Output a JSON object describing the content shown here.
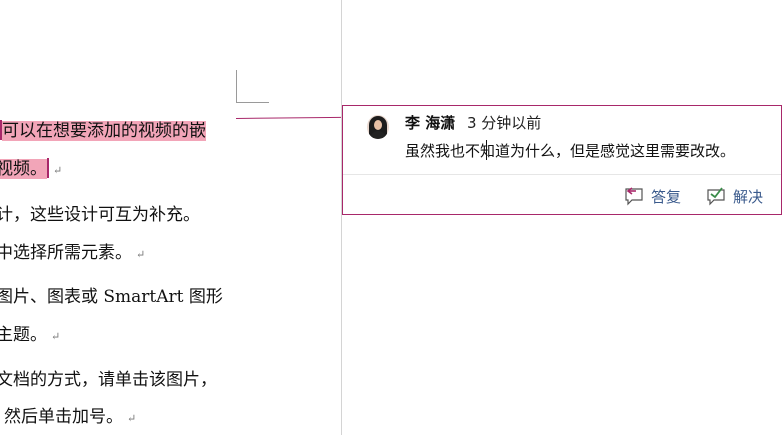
{
  "document": {
    "lines": [
      {
        "text": "可以在想要添加的视频的嵌",
        "highlighted": true,
        "caret_before": true,
        "paragraph_mark": false
      },
      {
        "text": "视频。",
        "highlighted": true,
        "caret_before": false,
        "caret_after": true,
        "paragraph_mark": true
      },
      {
        "text": "计，这些设计可互为补充。",
        "highlighted": false,
        "paragraph_mark": false
      },
      {
        "text": "中选择所需元素。",
        "highlighted": false,
        "paragraph_mark": true
      },
      {
        "text": "图片、图表或 SmartArt 图形",
        "highlighted": false,
        "paragraph_mark": false
      },
      {
        "text": "主题。",
        "highlighted": false,
        "paragraph_mark": true
      },
      {
        "text": "文档的方式，请单击该图片，",
        "highlighted": false,
        "paragraph_mark": false
      },
      {
        "text": "然后单击加号。",
        "highlighted": false,
        "paragraph_mark": true
      }
    ],
    "paragraph_mark_glyph": "↵"
  },
  "comment": {
    "author": "李 海潇",
    "time": "3 分钟以前",
    "body": "虽然我也不知道为什么，但是感觉这里需要改改。",
    "reply_label": "答复",
    "resolve_label": "解决",
    "accent_color": "#a8286a",
    "action_color": "#3a5a8c"
  },
  "icons": {
    "reply": "reply-icon",
    "resolve": "resolve-icon",
    "avatar": "avatar"
  }
}
